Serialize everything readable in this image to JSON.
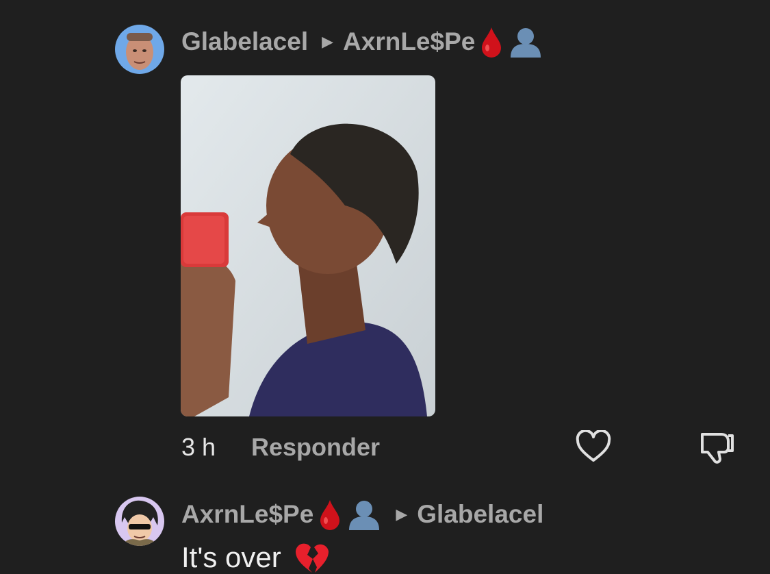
{
  "comments": [
    {
      "author": "Glabelacel",
      "reply_to": "AxrnLe$Pe",
      "reply_to_emojis": [
        "drop-of-blood-icon",
        "bust-in-silhouette-icon"
      ],
      "image": "mirror-selfie-photo",
      "time": "3 h",
      "reply_label": "Responder"
    },
    {
      "author": "AxrnLe$Pe",
      "author_emojis": [
        "drop-of-blood-icon",
        "bust-in-silhouette-icon"
      ],
      "reply_to": "Glabelacel",
      "text": "It's over"
    }
  ],
  "colors": {
    "background": "#1f1f1f",
    "username": "#a8a8a8",
    "timestamp": "#e6e6e6",
    "body_text": "#f0f0f0"
  }
}
